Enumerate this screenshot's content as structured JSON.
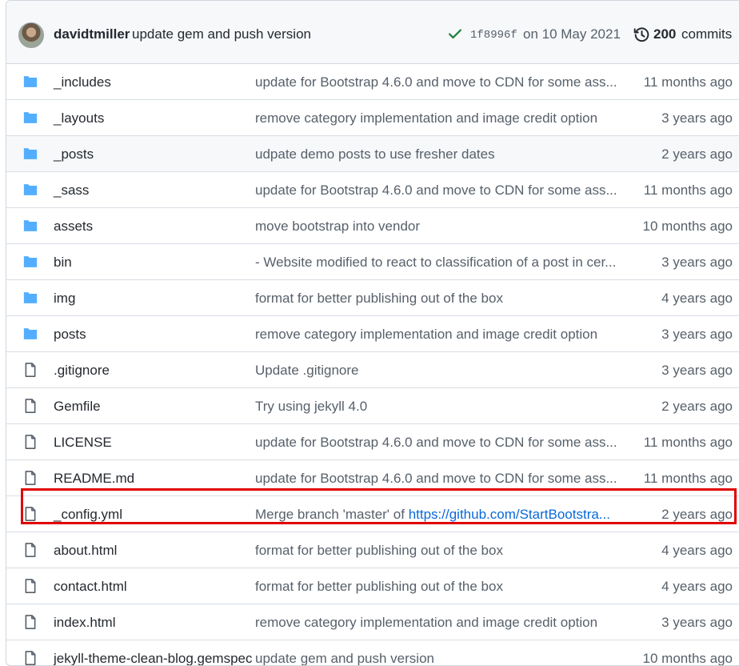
{
  "latest_commit": {
    "author": "davidtmiller",
    "message": "update gem and push version",
    "sha": "1f8996f",
    "date": "on 10 May 2021",
    "commits_count": "200",
    "commits_label": "commits"
  },
  "files": [
    {
      "type": "folder",
      "name": "_includes",
      "message": "update for Bootstrap 4.6.0 and move to CDN for some ass...",
      "age": "11 months ago"
    },
    {
      "type": "folder",
      "name": "_layouts",
      "message": "remove category implementation and image credit option",
      "age": "3 years ago"
    },
    {
      "type": "folder",
      "name": "_posts",
      "message": "udpate demo posts to use fresher dates",
      "age": "2 years ago"
    },
    {
      "type": "folder",
      "name": "_sass",
      "message": "update for Bootstrap 4.6.0 and move to CDN for some ass...",
      "age": "11 months ago"
    },
    {
      "type": "folder",
      "name": "assets",
      "message": "move bootstrap into vendor",
      "age": "10 months ago"
    },
    {
      "type": "folder",
      "name": "bin",
      "message": "- Website modified to react to classification of a post in cer...",
      "age": "3 years ago"
    },
    {
      "type": "folder",
      "name": "img",
      "message": "format for better publishing out of the box",
      "age": "4 years ago"
    },
    {
      "type": "folder",
      "name": "posts",
      "message": "remove category implementation and image credit option",
      "age": "3 years ago"
    },
    {
      "type": "file",
      "name": ".gitignore",
      "message": "Update .gitignore",
      "age": "3 years ago"
    },
    {
      "type": "file",
      "name": "Gemfile",
      "message": "Try using jekyll 4.0",
      "age": "2 years ago"
    },
    {
      "type": "file",
      "name": "LICENSE",
      "message": "update for Bootstrap 4.6.0 and move to CDN for some ass...",
      "age": "11 months ago"
    },
    {
      "type": "file",
      "name": "README.md",
      "message": "update for Bootstrap 4.6.0 and move to CDN for some ass...",
      "age": "11 months ago"
    },
    {
      "type": "file",
      "name": "_config.yml",
      "message": "Merge branch 'master' of ",
      "link": "https://github.com/StartBootstra...",
      "age": "2 years ago",
      "highlighted": true
    },
    {
      "type": "file",
      "name": "about.html",
      "message": "format for better publishing out of the box",
      "age": "4 years ago"
    },
    {
      "type": "file",
      "name": "contact.html",
      "message": "format for better publishing out of the box",
      "age": "4 years ago"
    },
    {
      "type": "file",
      "name": "index.html",
      "message": "remove category implementation and image credit option",
      "age": "3 years ago"
    },
    {
      "type": "file",
      "name": "jekyll-theme-clean-blog.gemspec",
      "message": "update gem and push version",
      "age": "10 months ago"
    }
  ],
  "colors": {
    "folder": "#54aeff",
    "highlight": "#e00000",
    "link": "#0969da"
  }
}
